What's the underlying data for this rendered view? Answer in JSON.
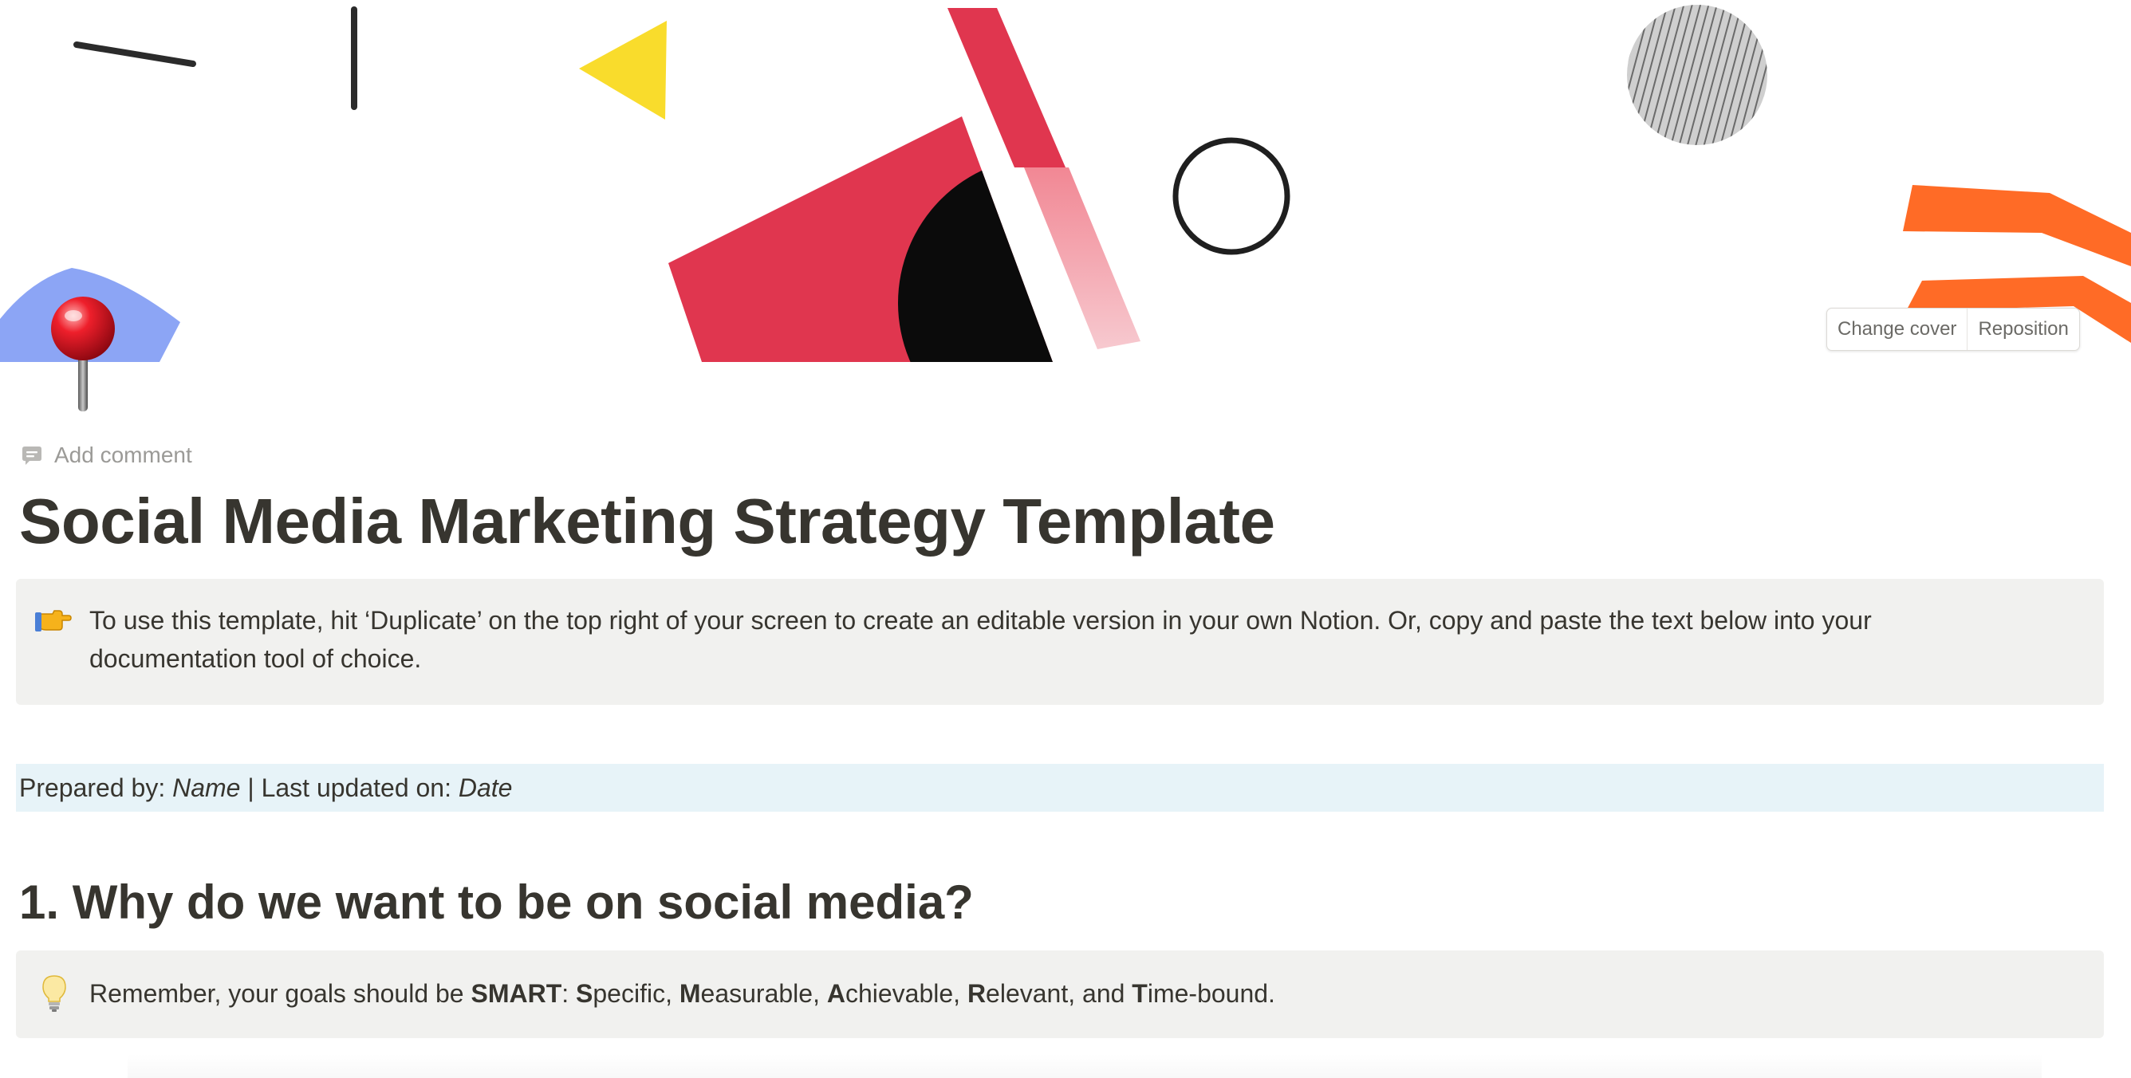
{
  "cover": {
    "change_cover_label": "Change cover",
    "reposition_label": "Reposition"
  },
  "page_icon": "pushpin-icon",
  "add_comment": {
    "icon": "comment-icon",
    "label": "Add comment"
  },
  "title": "Social Media Marketing Strategy Template",
  "intro_callout": {
    "icon": "pointing-hand-icon",
    "text": "To use this template, hit ‘Duplicate’ on the top right of your screen to create an editable version in your own Notion. Or, copy and paste the text below into your documentation tool of choice."
  },
  "prepared": {
    "prefix": "Prepared by: ",
    "name": "Name",
    "separator": " | Last updated on: ",
    "date": "Date"
  },
  "section1": {
    "heading": "1. Why do we want to be on social media?",
    "callout": {
      "icon": "lightbulb-icon",
      "lead": "Remember, your goals should be ",
      "smart": "SMART",
      "colon": ": ",
      "s_letter": "S",
      "s_rest": "pecific, ",
      "m_letter": "M",
      "m_rest": "easurable, ",
      "a_letter": "A",
      "a_rest": "chievable, ",
      "r_letter": "R",
      "r_rest": "elevant, and ",
      "t_letter": "T",
      "t_rest": "ime-bound."
    }
  },
  "colors": {
    "text": "#37352f",
    "callout_bg": "#f1f1ef",
    "highlight_blue_bg": "#e7f3f8",
    "cover_red": "#e0364f",
    "cover_yellow": "#f9dc2c",
    "cover_orange": "#ff6b26",
    "cover_blue": "#6f8ff2"
  }
}
